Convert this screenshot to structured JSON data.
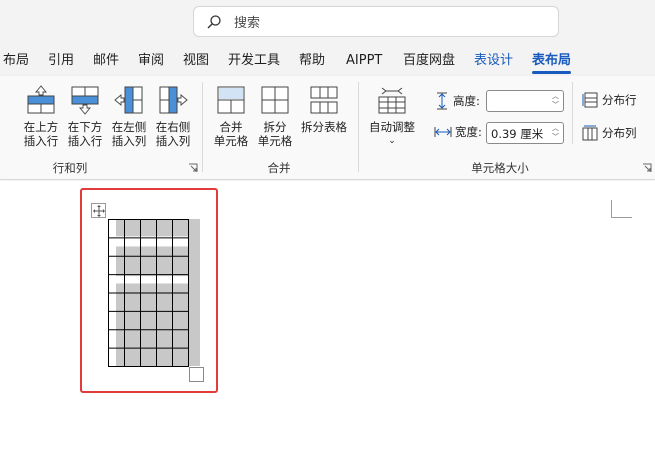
{
  "search": {
    "placeholder": "搜索"
  },
  "tabs": [
    {
      "label": "布局",
      "kind": "normal"
    },
    {
      "label": "引用",
      "kind": "normal"
    },
    {
      "label": "邮件",
      "kind": "normal"
    },
    {
      "label": "审阅",
      "kind": "normal"
    },
    {
      "label": "视图",
      "kind": "normal"
    },
    {
      "label": "开发工具",
      "kind": "normal"
    },
    {
      "label": "帮助",
      "kind": "normal"
    },
    {
      "label": "AIPPT",
      "kind": "normal"
    },
    {
      "label": "百度网盘",
      "kind": "normal"
    },
    {
      "label": "表设计",
      "kind": "context"
    },
    {
      "label": "表布局",
      "kind": "active"
    }
  ],
  "ribbon": {
    "rows_cols": {
      "group_label": "行和列",
      "insert_above": "在上方\n插入行",
      "insert_below": "在下方\n插入行",
      "insert_left": "在左侧\n插入列",
      "insert_right": "在右侧\n插入列"
    },
    "merge": {
      "group_label": "合并",
      "merge_cells": "合并\n单元格",
      "split_cells": "拆分\n单元格",
      "split_table": "拆分表格"
    },
    "cell_size": {
      "group_label": "单元格大小",
      "autofit": "自动调整",
      "height_label": "高度:",
      "height_value": "",
      "width_label": "宽度:",
      "width_value": "0.39 厘米",
      "distribute_rows": "分布行",
      "distribute_cols": "分布列"
    }
  },
  "colors": {
    "accent": "#185abd",
    "highlight": "#e23b3b",
    "cell_shade": "#c8c8c8"
  },
  "table": {
    "rows": 8,
    "cols": 5
  }
}
